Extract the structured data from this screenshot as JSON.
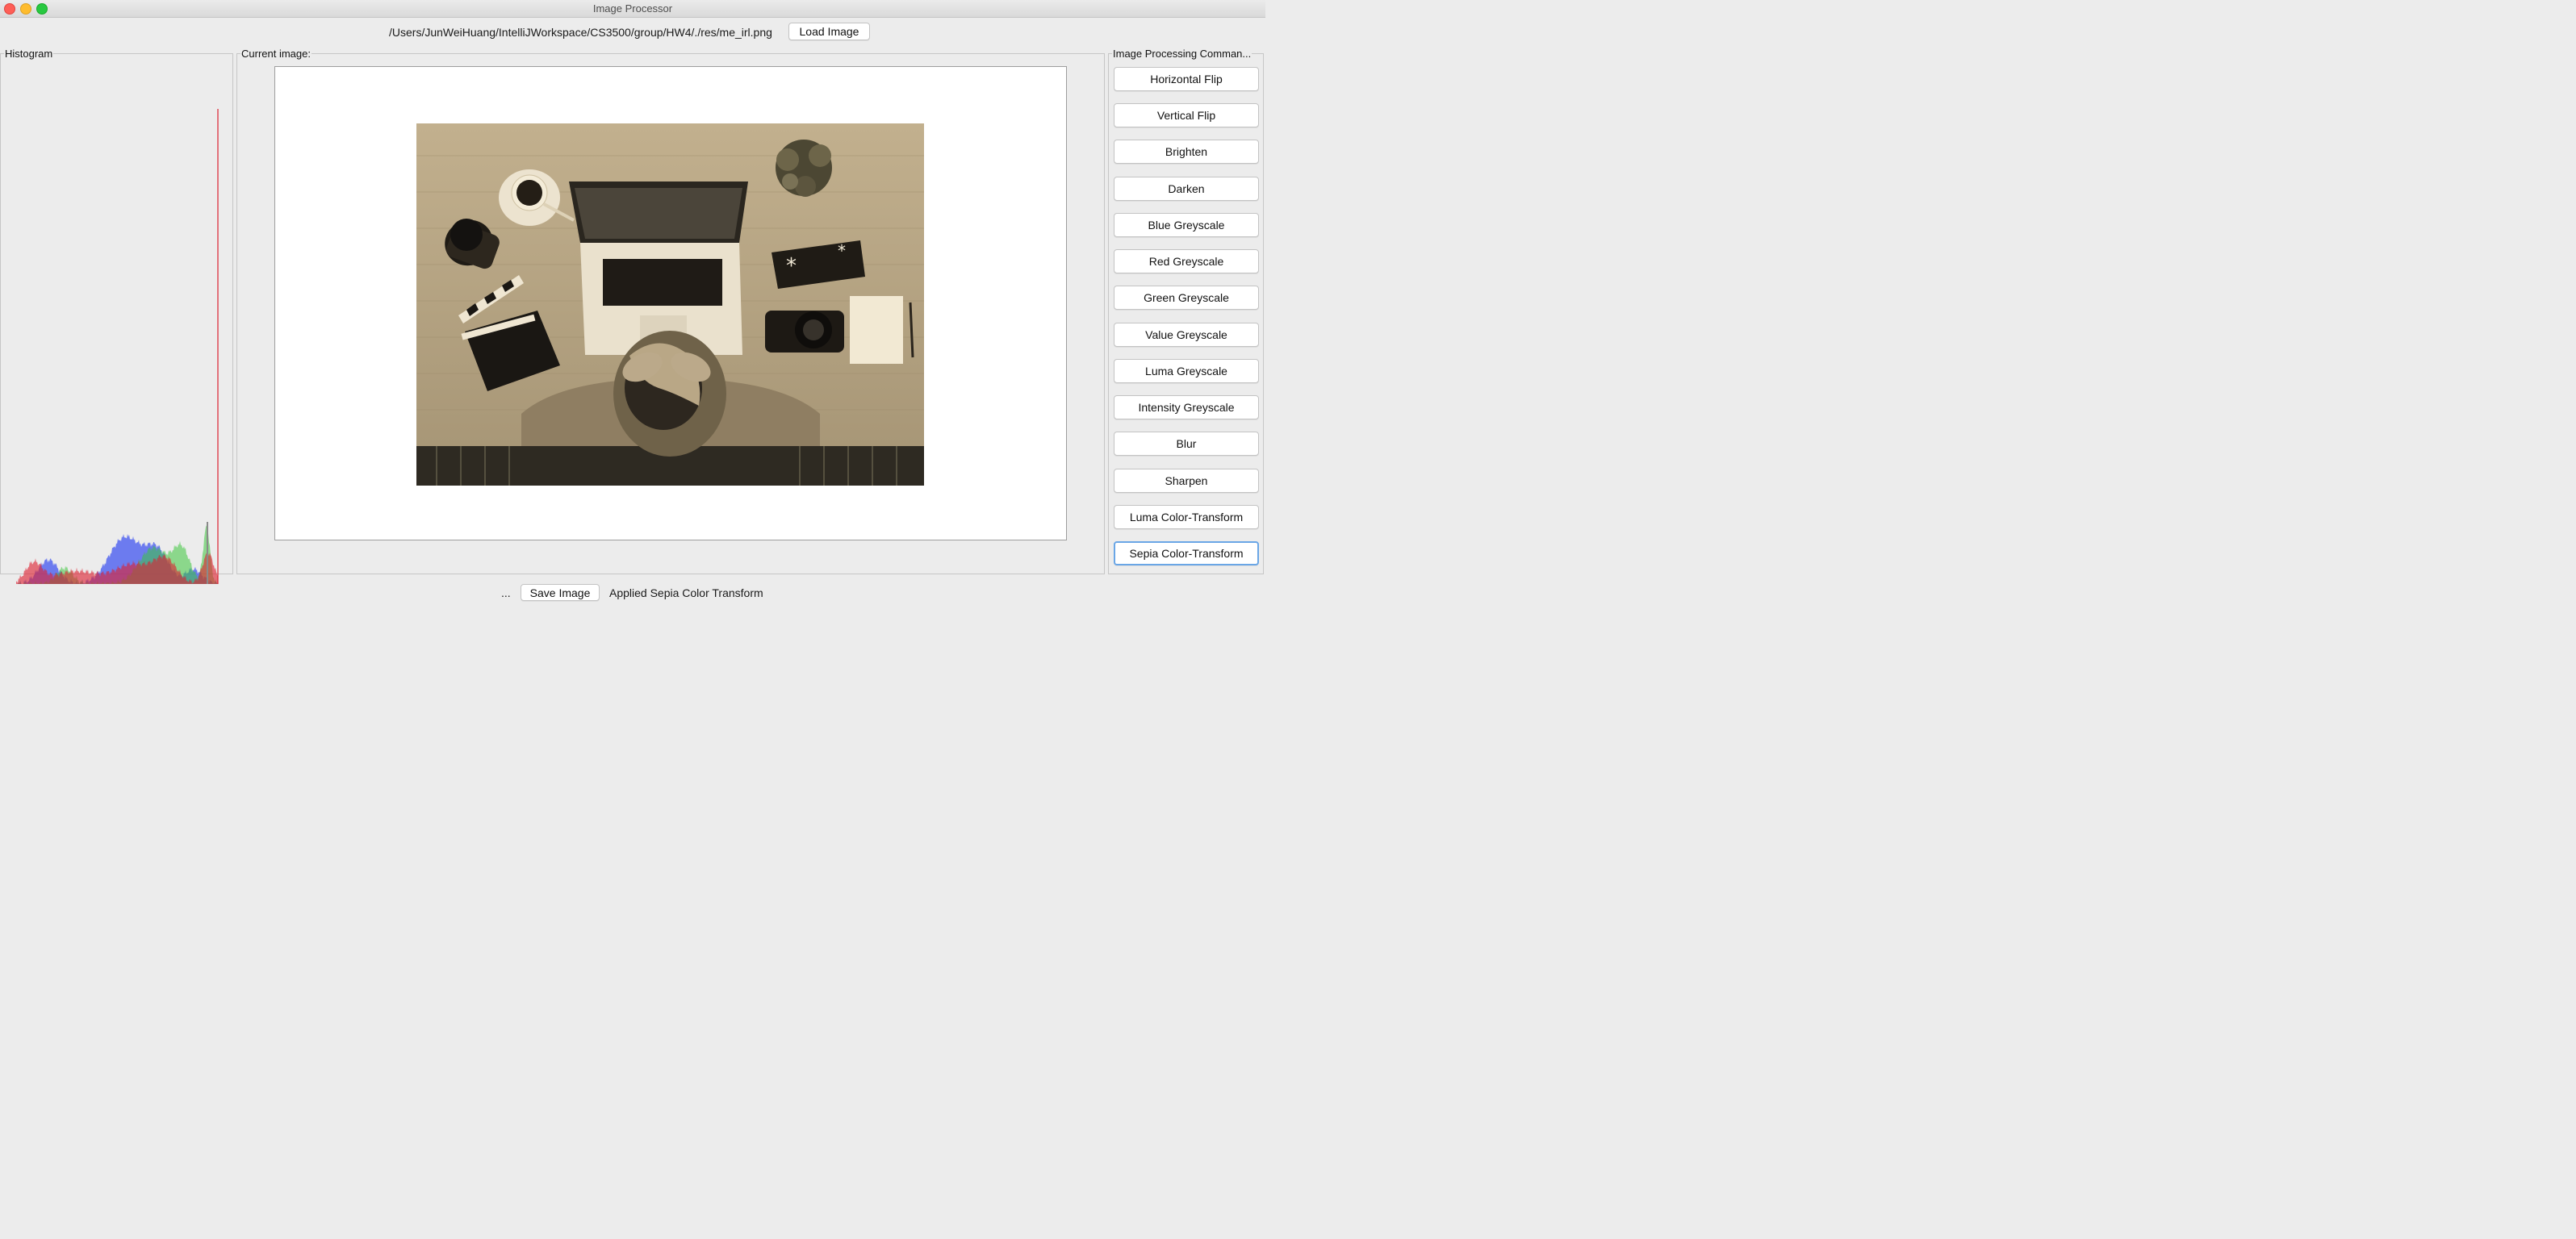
{
  "window": {
    "title": "Image Processor"
  },
  "top": {
    "file_path": "/Users/JunWeiHuang/IntelliJWorkspace/CS3500/group/HW4/./res/me_irl.png",
    "load_label": "Load Image"
  },
  "histogram": {
    "label": "Histogram"
  },
  "image_panel": {
    "label": "Current image:",
    "effect": "sepia"
  },
  "commands": {
    "label": "Image Processing Comman...",
    "items": [
      "Horizontal Flip",
      "Vertical Flip",
      "Brighten",
      "Darken",
      "Blue Greyscale",
      "Red Greyscale",
      "Green Greyscale",
      "Value Greyscale",
      "Luma Greyscale",
      "Intensity Greyscale",
      "Blur",
      "Sharpen",
      "Luma Color-Transform",
      "Sepia Color-Transform"
    ],
    "focused_index": 13
  },
  "bottom": {
    "ellipsis": "...",
    "save_label": "Save Image",
    "status": "Applied Sepia Color Transform"
  },
  "colors": {
    "hist_red": "#dd2030",
    "hist_green": "#3cc63c",
    "hist_blue": "#3a4ff0",
    "sepia_mid": "#c4b394",
    "accent": "#6aa6e6"
  }
}
